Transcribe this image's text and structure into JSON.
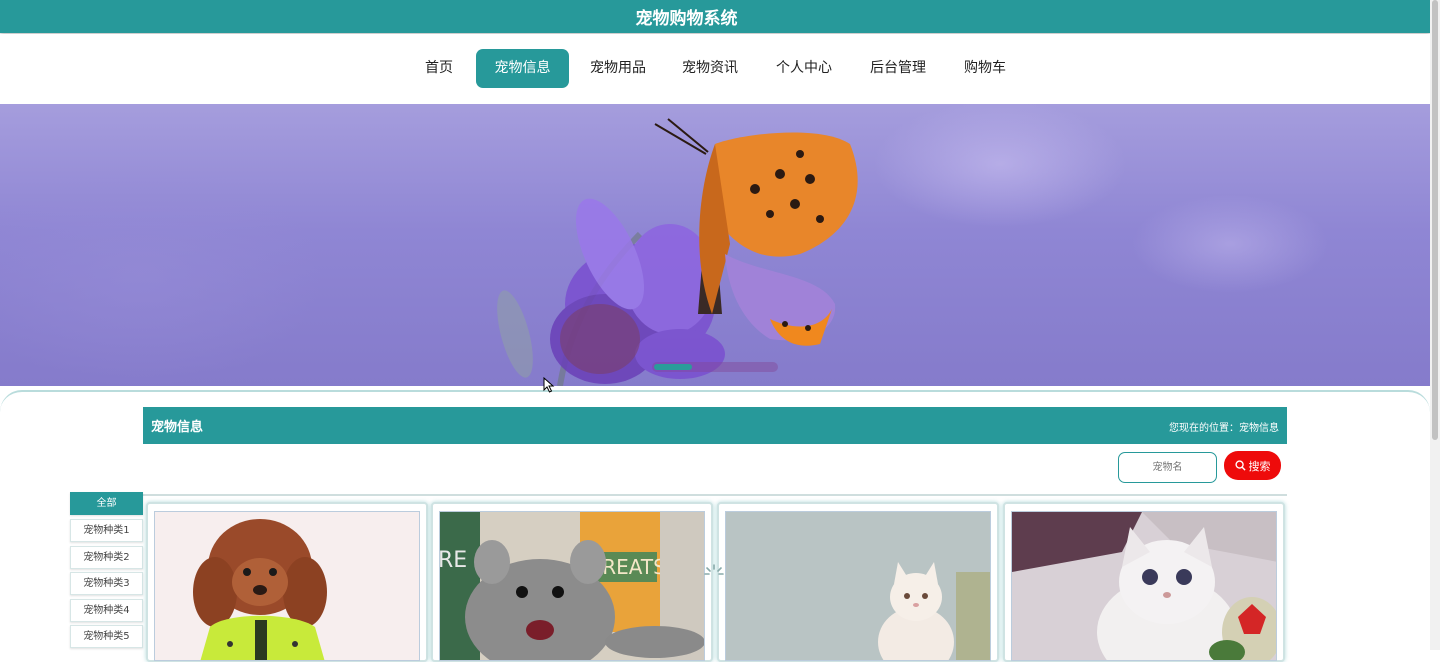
{
  "app": {
    "title": "宠物购物系统"
  },
  "nav": {
    "items": [
      {
        "label": "首页",
        "active": false
      },
      {
        "label": "宠物信息",
        "active": true
      },
      {
        "label": "宠物用品",
        "active": false
      },
      {
        "label": "宠物资讯",
        "active": false
      },
      {
        "label": "个人中心",
        "active": false
      },
      {
        "label": "后台管理",
        "active": false
      },
      {
        "label": "购物车",
        "active": false
      }
    ]
  },
  "section": {
    "title": "宠物信息",
    "breadcrumb": "您现在的位置：宠物信息"
  },
  "search": {
    "placeholder": "宠物名",
    "button_label": "搜索"
  },
  "categories": [
    {
      "label": "全部",
      "active": true
    },
    {
      "label": "宠物种类1",
      "active": false
    },
    {
      "label": "宠物种类2",
      "active": false
    },
    {
      "label": "宠物种类3",
      "active": false
    },
    {
      "label": "宠物种类4",
      "active": false
    },
    {
      "label": "宠物种类5",
      "active": false
    }
  ],
  "colors": {
    "accent": "#27999a",
    "search_button": "#ee0b0b"
  },
  "products": [
    {
      "image": "poodle-in-green-jacket"
    },
    {
      "image": "chinchilla-eating"
    },
    {
      "image": "white-persian-cat"
    },
    {
      "image": "white-british-shorthair-kitten"
    }
  ]
}
